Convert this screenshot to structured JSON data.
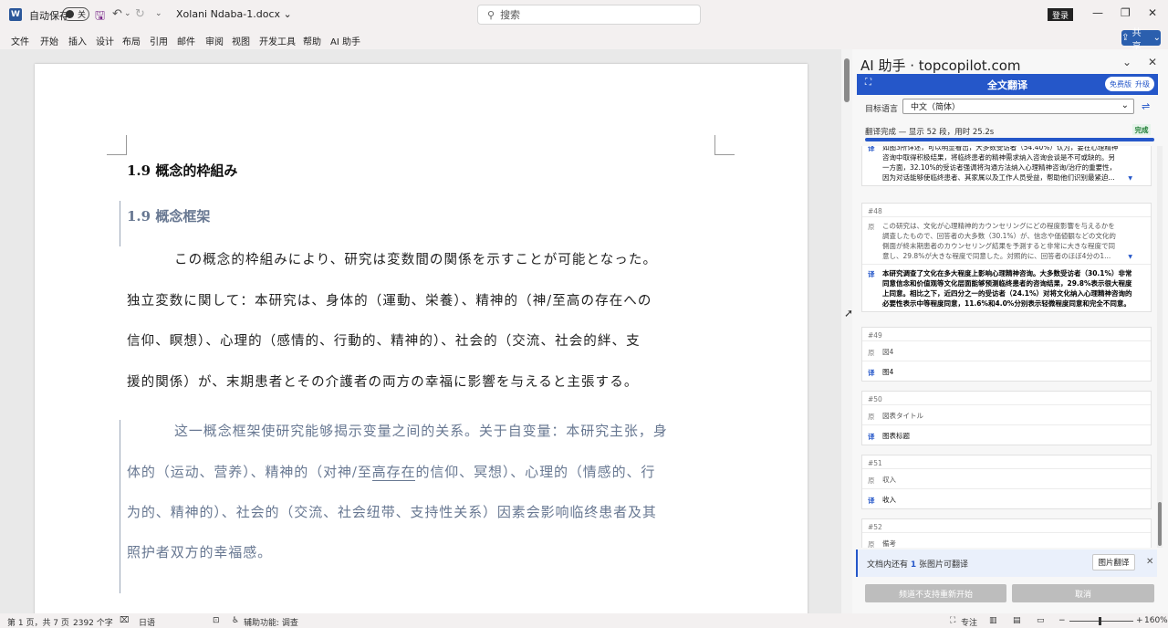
{
  "titlebar": {
    "autosave_label": "自动保存",
    "autosave_state": "关",
    "doc_title": "Xolani Ndaba-1.docx",
    "search_placeholder": "搜索",
    "login_label": "登录",
    "app_letter": "W"
  },
  "ribbon": {
    "tabs": [
      "文件",
      "开始",
      "插入",
      "设计",
      "布局",
      "引用",
      "邮件",
      "审阅",
      "视图",
      "开发工具",
      "帮助",
      "AI 助手"
    ],
    "share_label": "共享"
  },
  "document": {
    "heading_ja": "1.9 概念的枠組み",
    "heading_zh": "1.9 概念框架",
    "ja_lines": [
      "この概念的枠組みにより、研究は変数間の関係を示すことが可能となった。",
      "独立変数に関して：本研究は、身体的（運動、栄養）、精神的（神/至高の存在への",
      "信仰、瞑想）、心理的（感情的、行動的、精神的）、社会的（交流、社会的絆、支",
      "援的関係）が、末期患者とその介護者の両方の幸福に影響を与えると主張する。"
    ],
    "zh_lines": [
      "这一概念框架使研究能够揭示变量之间的关系。关于自变量：本研究主张，身",
      "体的（运动、营养）、精神的（对神/至",
      "高存在",
      "的信仰、冥想）、心理的（情感的、行",
      "为的、精神的）、社会的（交流、社会纽带、支持性关系）因素会影响临终患者及其",
      "照护者双方的幸福感。"
    ]
  },
  "panel": {
    "title": "AI 助手 · topcopilot.com",
    "mode_title": "全文翻译",
    "badge_free": "免费版",
    "badge_upgrade": "升级",
    "target_label": "目标语言",
    "target_value": "中文（简体）",
    "status": "翻译完成 — 显示 52 段，用时 25.2s",
    "done_label": "完成",
    "progress": 1.0,
    "cards": [
      {
        "num": "",
        "rows": [
          {
            "icon": "译",
            "type": "zh",
            "lines": [
              "如图3所详述，可以明显看出，大多数受访者（54.40%）认为，要在心理精神",
              "咨询中取得积极结果，将临终患者的精神需求纳入咨询会谈是不可或缺的。另",
              "一方面，32.10%的受访者强调将沟通方法纳入心理精神咨询/治疗的重要性，",
              "因为对话能够使临终患者、其家属以及工作人员受益，帮助他们识别最紧迫..."
            ]
          }
        ]
      },
      {
        "num": "#48",
        "rows": [
          {
            "icon": "原",
            "type": "src",
            "lines": [
              "この研究は、文化が心理精神的カウンセリングにどの程度影響を与えるかを",
              "調査したもので、回答者の大多数（30.1%）が、信念や価値観などの文化的",
              "側面が終末期患者のカウンセリング結果を予測すると非常に大きな程度で同",
              "意し、29.8%が大きな程度で同意した。対照的に、回答者のほぼ4分の1..."
            ]
          },
          {
            "icon": "译",
            "type": "zh-bold",
            "lines": [
              "本研究调查了文化在多大程度上影响心理精神咨询。大多数受访者（30.1%）非常",
              "同意信念和价值观等文化层面能够预测临终患者的咨询结果，29.8%表示很大程度",
              "上同意。相比之下，近四分之一的受访者（24.1%）对将文化纳入心理精神咨询的",
              "必要性表示中等程度同意，11.6%和4.0%分别表示轻微程度同意和完全不同意。"
            ]
          }
        ]
      },
      {
        "num": "#49",
        "rows": [
          {
            "icon": "原",
            "type": "src",
            "lines": [
              "図4"
            ]
          },
          {
            "icon": "译",
            "type": "zh",
            "lines": [
              "图4"
            ]
          }
        ]
      },
      {
        "num": "#50",
        "rows": [
          {
            "icon": "原",
            "type": "src",
            "lines": [
              "図表タイトル"
            ]
          },
          {
            "icon": "译",
            "type": "zh",
            "lines": [
              "图表标题"
            ]
          }
        ]
      },
      {
        "num": "#51",
        "rows": [
          {
            "icon": "原",
            "type": "src",
            "lines": [
              "収入"
            ]
          },
          {
            "icon": "译",
            "type": "zh",
            "lines": [
              "收入"
            ]
          }
        ]
      },
      {
        "num": "#52",
        "rows": [
          {
            "icon": "原",
            "type": "src",
            "lines": [
              "備考"
            ]
          }
        ]
      }
    ],
    "image_notice_pre": "文档内还有",
    "image_notice_count": "1",
    "image_notice_post": "张图片可翻译",
    "image_translate_btn": "图片翻译",
    "restart_btn": "频道不支持重新开始",
    "cancel_btn": "取消"
  },
  "statusbar": {
    "page": "第 1 页，共 7 页",
    "words": "2392 个字",
    "lang": "日语",
    "accessibility": "辅助功能: 调查",
    "focus": "专注",
    "zoom": "160%"
  },
  "colors": {
    "accent": "#2557c9",
    "translated_text": "#687892"
  }
}
